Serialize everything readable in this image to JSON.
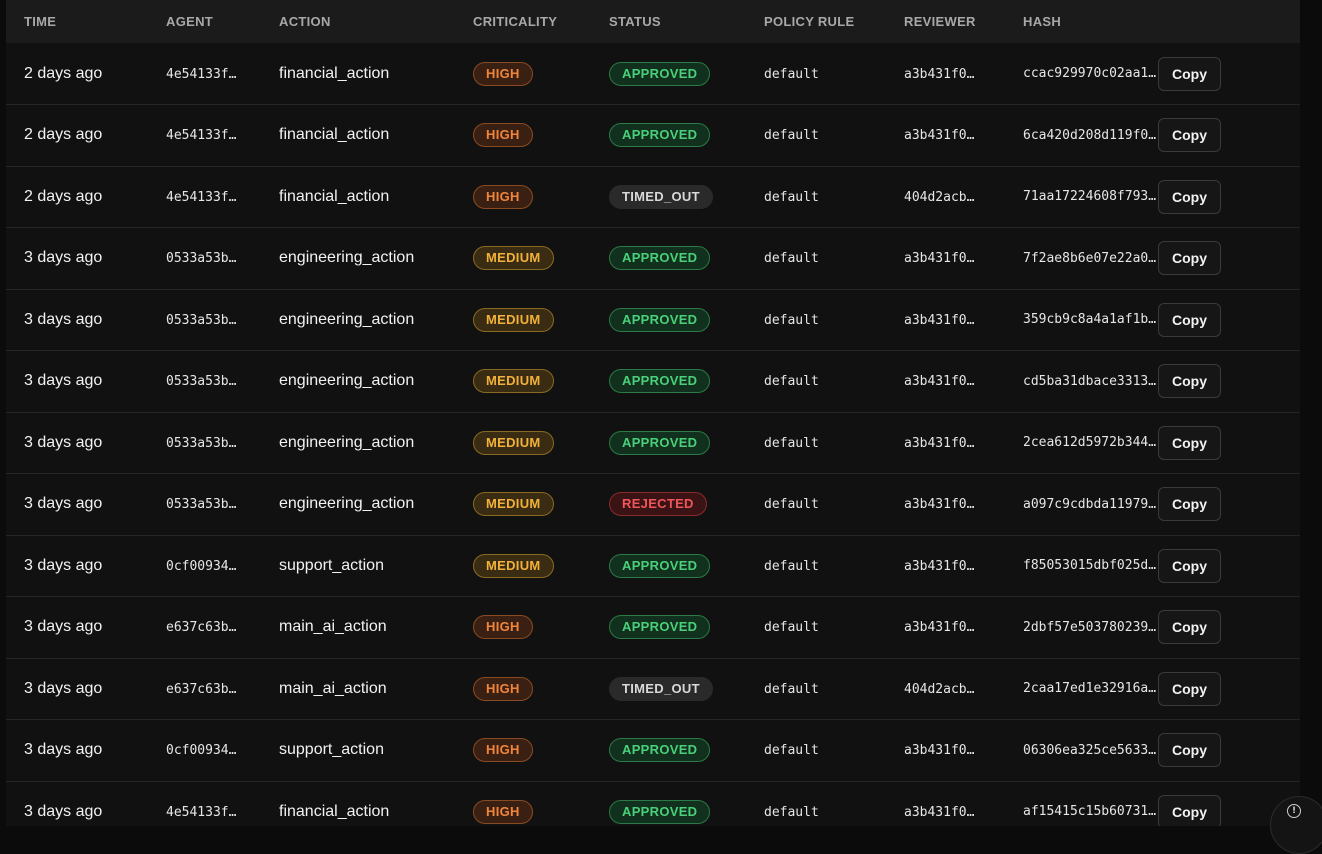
{
  "table": {
    "headers": {
      "time": "TIME",
      "agent": "AGENT",
      "action": "ACTION",
      "criticality": "CRITICALITY",
      "status": "STATUS",
      "policy_rule": "POLICY RULE",
      "reviewer": "REVIEWER",
      "hash": "HASH"
    },
    "copy_label": "Copy",
    "rows": [
      {
        "time": "2 days ago",
        "agent": "4e54133f…",
        "action": "financial_action",
        "criticality": "HIGH",
        "status": "APPROVED",
        "policy_rule": "default",
        "reviewer": "a3b431f0…",
        "hash": "ccac929970c02aa1…"
      },
      {
        "time": "2 days ago",
        "agent": "4e54133f…",
        "action": "financial_action",
        "criticality": "HIGH",
        "status": "APPROVED",
        "policy_rule": "default",
        "reviewer": "a3b431f0…",
        "hash": "6ca420d208d119f0…"
      },
      {
        "time": "2 days ago",
        "agent": "4e54133f…",
        "action": "financial_action",
        "criticality": "HIGH",
        "status": "TIMED_OUT",
        "policy_rule": "default",
        "reviewer": "404d2acb…",
        "hash": "71aa17224608f793…"
      },
      {
        "time": "3 days ago",
        "agent": "0533a53b…",
        "action": "engineering_action",
        "criticality": "MEDIUM",
        "status": "APPROVED",
        "policy_rule": "default",
        "reviewer": "a3b431f0…",
        "hash": "7f2ae8b6e07e22a0…"
      },
      {
        "time": "3 days ago",
        "agent": "0533a53b…",
        "action": "engineering_action",
        "criticality": "MEDIUM",
        "status": "APPROVED",
        "policy_rule": "default",
        "reviewer": "a3b431f0…",
        "hash": "359cb9c8a4a1af1b…"
      },
      {
        "time": "3 days ago",
        "agent": "0533a53b…",
        "action": "engineering_action",
        "criticality": "MEDIUM",
        "status": "APPROVED",
        "policy_rule": "default",
        "reviewer": "a3b431f0…",
        "hash": "cd5ba31dbace3313…"
      },
      {
        "time": "3 days ago",
        "agent": "0533a53b…",
        "action": "engineering_action",
        "criticality": "MEDIUM",
        "status": "APPROVED",
        "policy_rule": "default",
        "reviewer": "a3b431f0…",
        "hash": "2cea612d5972b344…"
      },
      {
        "time": "3 days ago",
        "agent": "0533a53b…",
        "action": "engineering_action",
        "criticality": "MEDIUM",
        "status": "REJECTED",
        "policy_rule": "default",
        "reviewer": "a3b431f0…",
        "hash": "a097c9cdbda11979…"
      },
      {
        "time": "3 days ago",
        "agent": "0cf00934…",
        "action": "support_action",
        "criticality": "MEDIUM",
        "status": "APPROVED",
        "policy_rule": "default",
        "reviewer": "a3b431f0…",
        "hash": "f85053015dbf025d…"
      },
      {
        "time": "3 days ago",
        "agent": "e637c63b…",
        "action": "main_ai_action",
        "criticality": "HIGH",
        "status": "APPROVED",
        "policy_rule": "default",
        "reviewer": "a3b431f0…",
        "hash": "2dbf57e503780239…"
      },
      {
        "time": "3 days ago",
        "agent": "e637c63b…",
        "action": "main_ai_action",
        "criticality": "HIGH",
        "status": "TIMED_OUT",
        "policy_rule": "default",
        "reviewer": "404d2acb…",
        "hash": "2caa17ed1e32916a…"
      },
      {
        "time": "3 days ago",
        "agent": "0cf00934…",
        "action": "support_action",
        "criticality": "HIGH",
        "status": "APPROVED",
        "policy_rule": "default",
        "reviewer": "a3b431f0…",
        "hash": "06306ea325ce5633…"
      },
      {
        "time": "3 days ago",
        "agent": "4e54133f…",
        "action": "financial_action",
        "criticality": "HIGH",
        "status": "APPROVED",
        "policy_rule": "default",
        "reviewer": "a3b431f0…",
        "hash": "af15415c15b60731…"
      }
    ]
  },
  "colors": {
    "background": "#111111",
    "header_bg": "#1b1b1b",
    "high": "#f2853a",
    "medium": "#f2b13a",
    "approved": "#4ad07a",
    "timed_out": "#d9d9d9",
    "rejected": "#f0555a"
  },
  "icons": {
    "info_button": "info-icon"
  }
}
